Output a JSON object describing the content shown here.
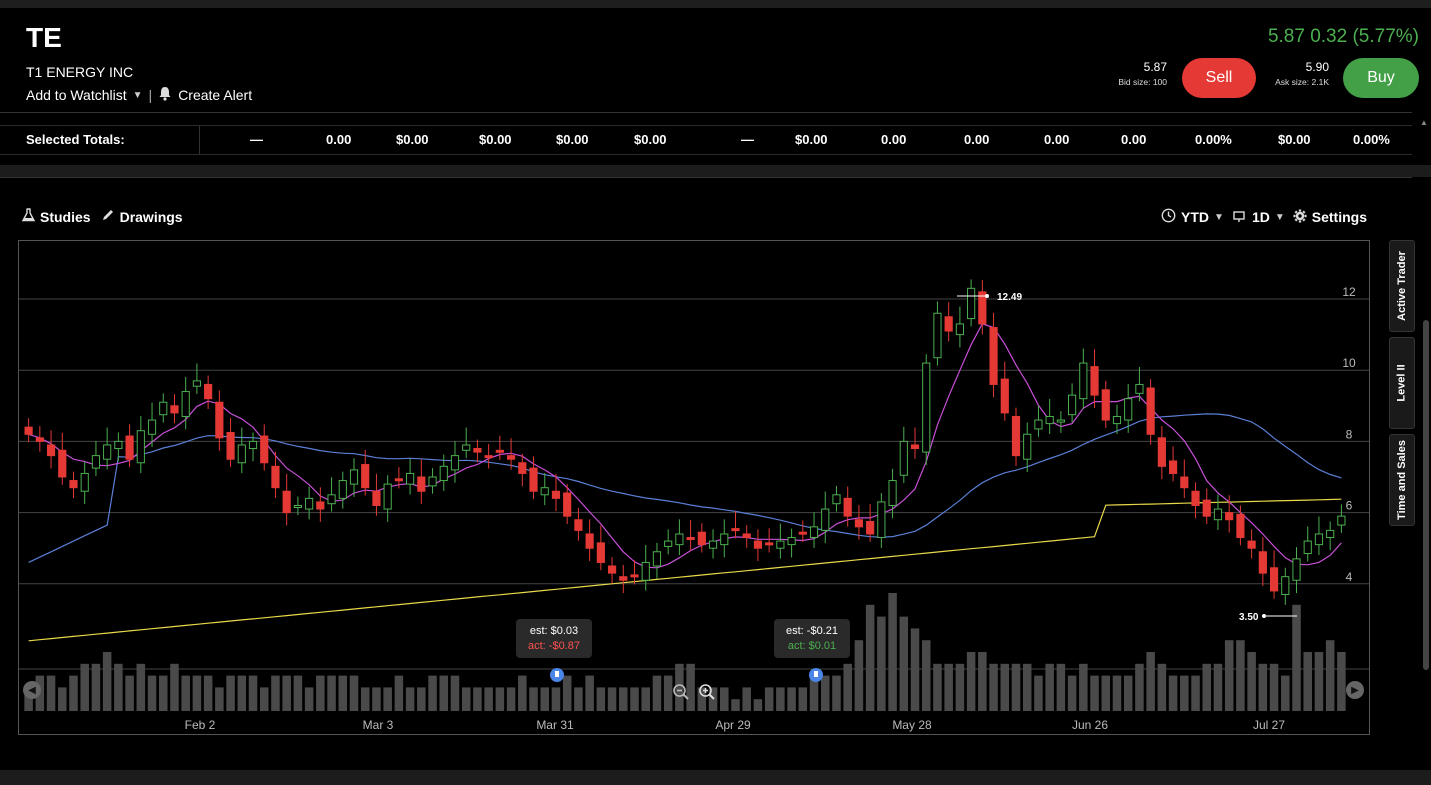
{
  "header": {
    "symbol": "TE",
    "company": "T1 ENERGY INC",
    "add_watchlist": "Add to Watchlist",
    "create_alert": "Create Alert",
    "price_line": "5.87 0.32 (5.77%)",
    "bid": "5.87",
    "bid_size": "Bid size: 100",
    "ask": "5.90",
    "ask_size": "Ask size: 2.1K",
    "sell_label": "Sell",
    "buy_label": "Buy"
  },
  "totals": {
    "label": "Selected Totals:",
    "cells": [
      "—",
      "0.00",
      "$0.00",
      "$0.00",
      "$0.00",
      "$0.00",
      "—",
      "$0.00",
      "0.00",
      "0.00",
      "0.00",
      "0.00",
      "0.00%",
      "$0.00",
      "0.00%"
    ]
  },
  "toolbar": {
    "studies": "Studies",
    "drawings": "Drawings",
    "range": "YTD",
    "interval": "1D",
    "settings": "Settings"
  },
  "side_tabs": [
    "Active Trader",
    "Level II",
    "Time and Sales"
  ],
  "earnings": [
    {
      "est": "est: $0.03",
      "act": "act: -$0.87",
      "beat": false
    },
    {
      "est": "est: -$0.21",
      "act": "act: $0.01",
      "beat": true
    }
  ],
  "colors": {
    "up": "#4caf50",
    "down": "#e53935",
    "ma_short": "#c84fd8",
    "ma_mid": "#5b7fd6",
    "ma_long": "#e8d84a",
    "volume": "#4a4a4a"
  },
  "chart_data": {
    "type": "candlestick",
    "x_tick_labels": [
      "Feb 2",
      "Mar 3",
      "Mar 31",
      "Apr 29",
      "May 28",
      "Jun 26",
      "Jul 27"
    ],
    "y_tick_labels": [
      "12",
      "10",
      "8",
      "6",
      "4"
    ],
    "ylim": [
      1.5,
      14.5
    ],
    "high_marker": "12.49",
    "low_marker": "3.50",
    "close": [
      8.2,
      8.0,
      7.6,
      7.0,
      6.7,
      7.1,
      7.6,
      7.9,
      8.0,
      7.5,
      8.3,
      8.6,
      9.1,
      8.8,
      9.4,
      9.7,
      9.2,
      8.1,
      7.5,
      7.9,
      8.0,
      7.4,
      6.7,
      6.0,
      6.2,
      6.4,
      6.1,
      6.5,
      6.9,
      7.2,
      6.7,
      6.2,
      6.8,
      6.9,
      7.1,
      6.6,
      7.0,
      7.3,
      7.6,
      7.9,
      7.7,
      7.6,
      7.7,
      7.5,
      7.1,
      6.6,
      6.7,
      6.4,
      5.9,
      5.5,
      5.0,
      4.6,
      4.3,
      4.1,
      4.2,
      4.6,
      4.9,
      5.2,
      5.4,
      5.3,
      5.1,
      5.2,
      5.4,
      5.5,
      5.3,
      5.0,
      5.1,
      5.2,
      5.3,
      5.4,
      5.6,
      6.1,
      6.5,
      5.9,
      5.6,
      5.4,
      6.3,
      6.9,
      8.0,
      7.8,
      10.2,
      11.6,
      11.1,
      11.3,
      12.3,
      11.3,
      9.6,
      8.8,
      7.6,
      8.2,
      8.6,
      8.7,
      8.6,
      9.3,
      10.2,
      9.3,
      8.6,
      8.7,
      9.2,
      9.6,
      8.2,
      7.3,
      7.1,
      6.7,
      6.2,
      5.9,
      6.1,
      5.8,
      5.3,
      5.0,
      4.3,
      3.8,
      4.2,
      4.7,
      5.2,
      5.4,
      5.5,
      5.9
    ],
    "volume_scale": [
      0.2,
      0.3,
      0.3,
      0.2,
      0.3,
      0.4,
      0.4,
      0.5,
      0.4,
      0.3,
      0.4,
      0.3,
      0.3,
      0.4,
      0.3,
      0.3,
      0.3,
      0.2,
      0.3,
      0.3,
      0.3,
      0.2,
      0.3,
      0.3,
      0.3,
      0.2,
      0.3,
      0.3,
      0.3,
      0.3,
      0.2,
      0.2,
      0.2,
      0.3,
      0.2,
      0.2,
      0.3,
      0.3,
      0.3,
      0.2,
      0.2,
      0.2,
      0.2,
      0.2,
      0.3,
      0.2,
      0.2,
      0.2,
      0.3,
      0.2,
      0.3,
      0.2,
      0.2,
      0.2,
      0.2,
      0.2,
      0.3,
      0.3,
      0.4,
      0.4,
      0.2,
      0.2,
      0.2,
      0.1,
      0.2,
      0.1,
      0.2,
      0.2,
      0.2,
      0.2,
      0.3,
      0.3,
      0.3,
      0.4,
      0.6,
      0.9,
      0.8,
      1.0,
      0.8,
      0.7,
      0.6,
      0.4,
      0.4,
      0.4,
      0.5,
      0.5,
      0.4,
      0.4,
      0.4,
      0.4,
      0.3,
      0.4,
      0.4,
      0.3,
      0.4,
      0.3,
      0.3,
      0.3,
      0.3,
      0.4,
      0.5,
      0.4,
      0.3,
      0.3,
      0.3,
      0.4,
      0.4,
      0.6,
      0.6,
      0.5,
      0.4,
      0.4,
      0.3,
      0.9,
      0.5,
      0.5,
      0.6,
      0.5
    ]
  }
}
